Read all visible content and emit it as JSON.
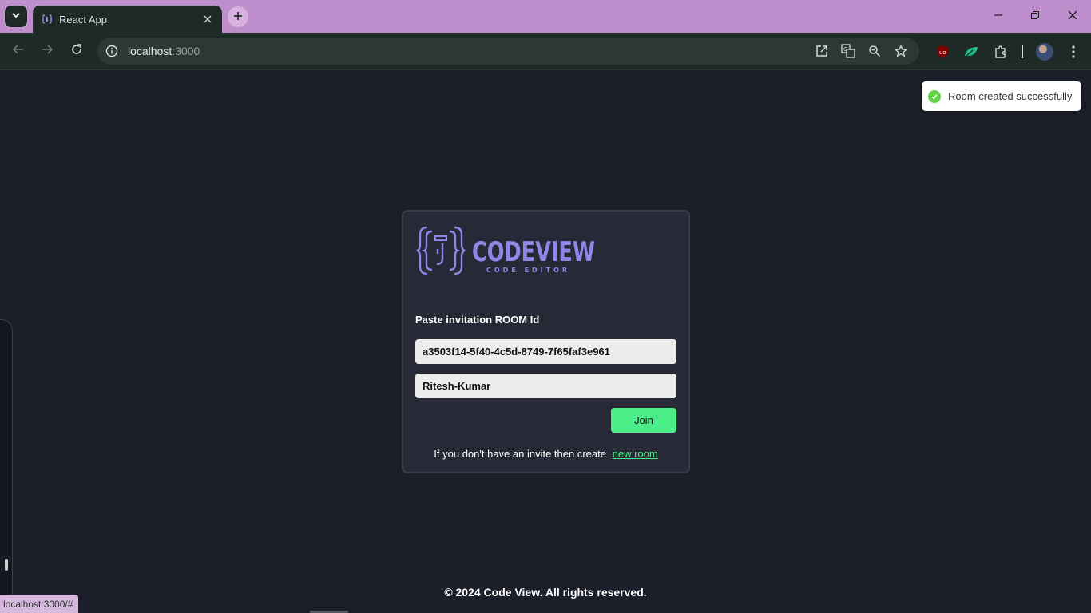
{
  "browser": {
    "tab_title": "React App",
    "url_host": "localhost",
    "url_port": ":3000",
    "status_url": "localhost:3000/#"
  },
  "toast": {
    "message": "Room created successfully"
  },
  "card": {
    "logo_title": "CODEVIEW",
    "logo_subtitle": "CODE EDITOR",
    "label": "Paste invitation ROOM Id",
    "room_id_value": "a3503f14-5f40-4c5d-8749-7f65faf3e961",
    "username_value": "Ritesh-Kumar",
    "join_label": "Join",
    "invite_text": "If you don't have an invite then create",
    "new_room_link": "new room"
  },
  "footer": {
    "text": "© 2024 Code View. All rights reserved."
  },
  "colors": {
    "page_bg": "#1c1e29",
    "card_bg": "#272a36",
    "accent_green": "#4aed88",
    "logo_purple": "#8f86e8",
    "tabstrip_bg": "#bf8ecc",
    "toolbar_bg": "#1e2a26"
  }
}
